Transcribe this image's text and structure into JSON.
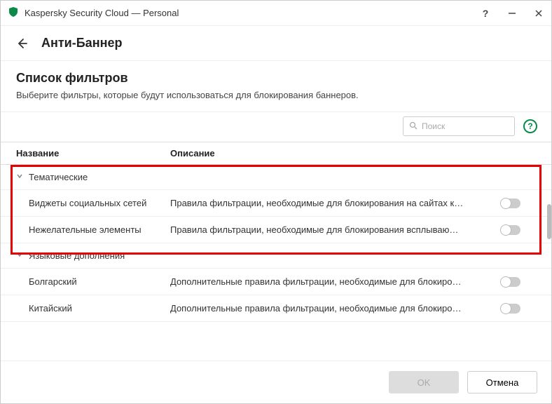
{
  "app": {
    "title": "Kaspersky Security Cloud — Personal",
    "icon": "shield"
  },
  "header": {
    "section": "Анти-Баннер"
  },
  "subheader": {
    "title": "Список фильтров",
    "description": "Выберите фильтры, которые будут использоваться для блокирования баннеров."
  },
  "search": {
    "placeholder": "Поиск"
  },
  "columns": {
    "name": "Название",
    "description": "Описание"
  },
  "groups": [
    {
      "name": "Тематические",
      "expanded": true,
      "highlight": true,
      "items": [
        {
          "name": "Виджеты социальных сетей",
          "description": "Правила фильтрации, необходимые для блокирования на сайтах к…",
          "enabled": false
        },
        {
          "name": "Нежелательные элементы",
          "description": "Правила фильтрации, необходимые для блокирования всплываю…",
          "enabled": false
        }
      ]
    },
    {
      "name": "Языковые дополнения",
      "expanded": true,
      "highlight": false,
      "items": [
        {
          "name": "Болгарский",
          "description": "Дополнительные правила фильтрации, необходимые для блокиро…",
          "enabled": false
        },
        {
          "name": "Китайский",
          "description": "Дополнительные правила фильтрации, необходимые для блокиро…",
          "enabled": false
        }
      ]
    }
  ],
  "footer": {
    "ok": "OK",
    "cancel": "Отмена"
  }
}
